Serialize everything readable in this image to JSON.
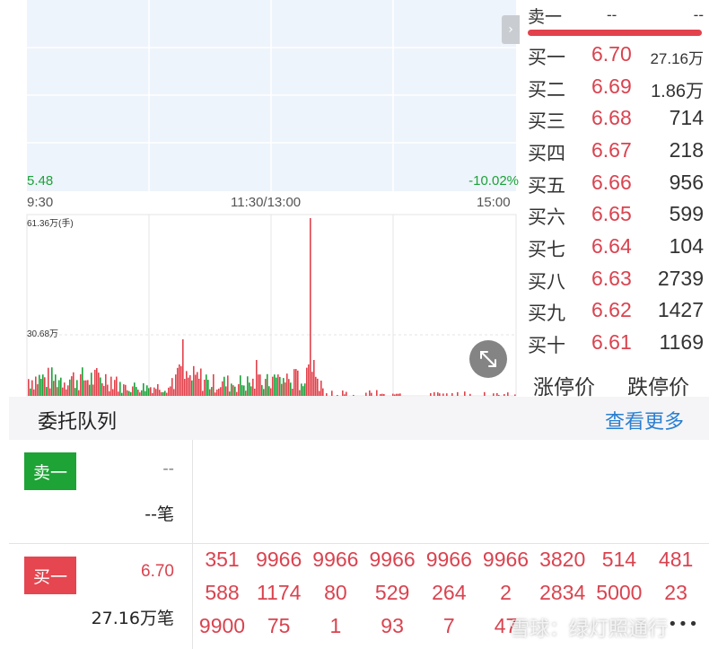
{
  "chart": {
    "low_price": "5.48",
    "low_pct": "-10.02%",
    "time_open": "9:30",
    "time_mid": "11:30/13:00",
    "time_close": "15:00",
    "volume_max_label": "61.36万(手)",
    "volume_mid_label": "30.68万",
    "colors": {
      "up": "#e2424c",
      "down": "#1aa23a",
      "grid_bg": "#eef4fb"
    }
  },
  "order_book": {
    "sell": {
      "label": "卖一",
      "price": "--",
      "volume": "--"
    },
    "buy_levels": [
      {
        "label": "买一",
        "price": "6.70",
        "volume": "27.16万"
      },
      {
        "label": "买二",
        "price": "6.69",
        "volume": "1.86万"
      },
      {
        "label": "买三",
        "price": "6.68",
        "volume": "714"
      },
      {
        "label": "买四",
        "price": "6.67",
        "volume": "218"
      },
      {
        "label": "买五",
        "price": "6.66",
        "volume": "956"
      },
      {
        "label": "买六",
        "price": "6.65",
        "volume": "599"
      },
      {
        "label": "买七",
        "price": "6.64",
        "volume": "104"
      },
      {
        "label": "买八",
        "price": "6.63",
        "volume": "2739"
      },
      {
        "label": "买九",
        "price": "6.62",
        "volume": "1427"
      },
      {
        "label": "买十",
        "price": "6.61",
        "volume": "1169"
      }
    ],
    "limit_up_label": "涨停价",
    "limit_down_label": "跌停价"
  },
  "queue": {
    "title": "委托队列",
    "view_more": "查看更多",
    "sell": {
      "badge": "卖一",
      "price": "--",
      "count": "--笔"
    },
    "buy": {
      "badge": "买一",
      "price": "6.70",
      "count": "27.16万笔",
      "orders": [
        [
          "351",
          "9966",
          "9966",
          "9966",
          "9966",
          "9966",
          "3820",
          "514",
          "481"
        ],
        [
          "588",
          "1174",
          "80",
          "529",
          "264",
          "2",
          "2834",
          "5000",
          "23"
        ],
        [
          "9900",
          "75",
          "1",
          "93",
          "7",
          "47",
          "",
          "",
          ""
        ]
      ]
    }
  },
  "watermark": "雪球：绿灯照通行",
  "more_dots": "•••"
}
